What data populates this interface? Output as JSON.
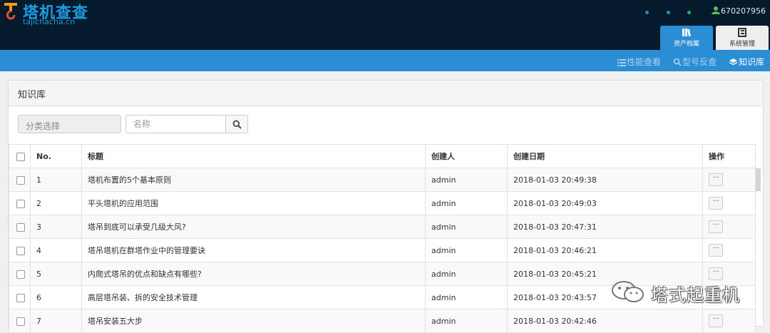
{
  "brand": {
    "title": "塔机查查",
    "subtitle": "tajichacha.cn",
    "color": "#1e9be0"
  },
  "user": {
    "id": "670207956"
  },
  "top_tabs": [
    {
      "label": "资产档案",
      "icon": "asset-archive-icon",
      "active": true
    },
    {
      "label": "系统管理",
      "icon": "system-manage-icon",
      "active": false
    }
  ],
  "nav": [
    {
      "label": "性能查看",
      "icon": "list-icon",
      "active": false
    },
    {
      "label": "型号反查",
      "icon": "search-icon",
      "active": false
    },
    {
      "label": "知识库",
      "icon": "layers-icon",
      "active": true
    }
  ],
  "panel": {
    "title": "知识库"
  },
  "filters": {
    "category_placeholder": "分类选择",
    "name_placeholder": "名称"
  },
  "table": {
    "headers": [
      "No.",
      "标题",
      "创建人",
      "创建日期",
      "操作"
    ],
    "rows": [
      {
        "no": "1",
        "title": "塔机布置的5个基本原则",
        "creator": "admin",
        "date": "2018-01-03 20:49:38",
        "action": "···"
      },
      {
        "no": "2",
        "title": "平头塔机的应用范围",
        "creator": "admin",
        "date": "2018-01-03 20:49:03",
        "action": "···"
      },
      {
        "no": "3",
        "title": "塔吊到底可以承受几级大风?",
        "creator": "admin",
        "date": "2018-01-03 20:47:31",
        "action": "···"
      },
      {
        "no": "4",
        "title": "塔吊塔机在群塔作业中的管理要诀",
        "creator": "admin",
        "date": "2018-01-03 20:46:21",
        "action": "···"
      },
      {
        "no": "5",
        "title": "内爬式塔吊的优点和缺点有哪些?",
        "creator": "admin",
        "date": "2018-01-03 20:45:21",
        "action": "···"
      },
      {
        "no": "6",
        "title": "高层塔吊装、拆的安全技术管理",
        "creator": "admin",
        "date": "2018-01-03 20:43:57",
        "action": "···"
      },
      {
        "no": "7",
        "title": "塔吊安装五大步",
        "creator": "admin",
        "date": "2018-01-03 20:42:46",
        "action": "···"
      }
    ]
  },
  "watermark": {
    "text": "塔式起重机",
    "icon": "wechat-icon"
  },
  "colors": {
    "header_bg": "#061a2e",
    "nav_bg": "#2b8dd4",
    "accent": "#1e9be0"
  }
}
